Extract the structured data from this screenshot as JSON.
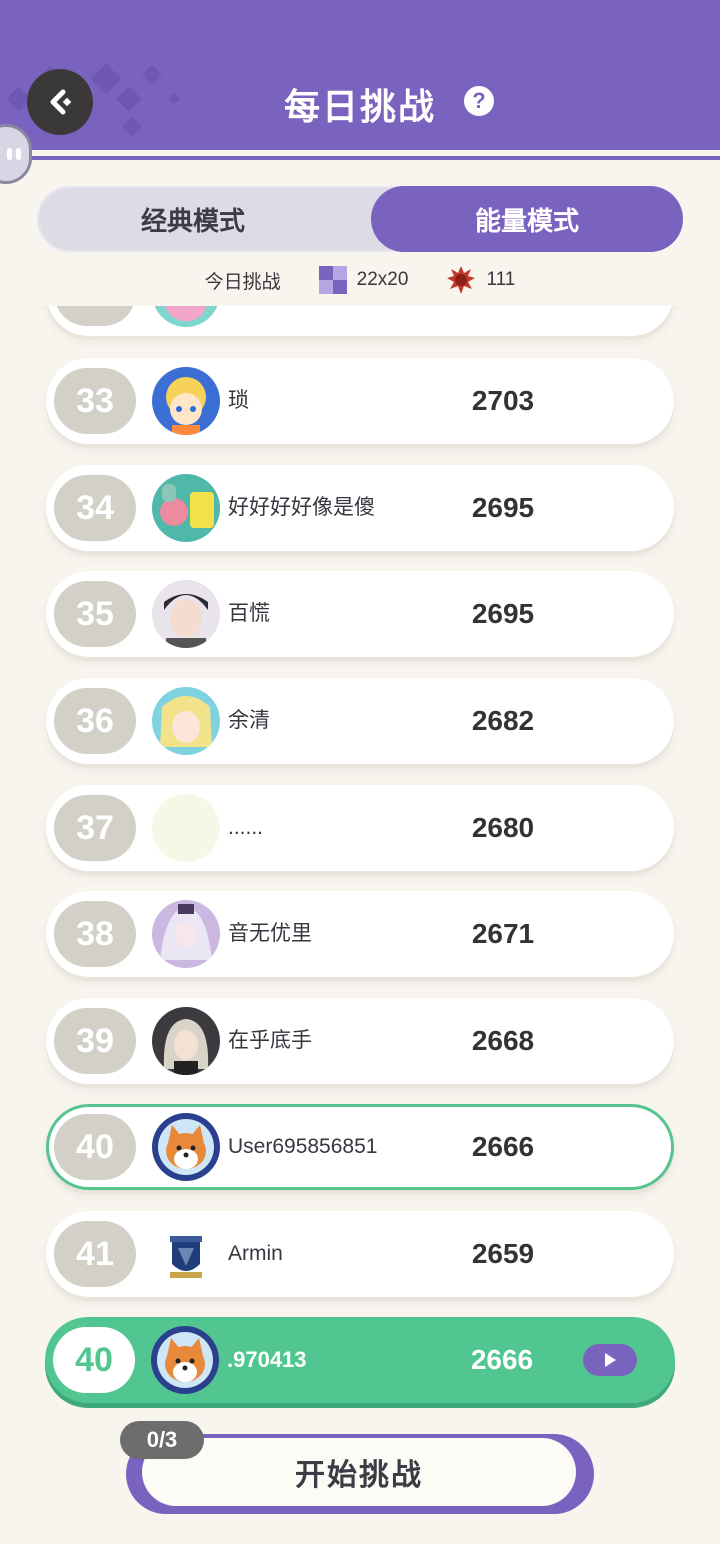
{
  "header": {
    "title": "每日挑战",
    "help_icon": "?"
  },
  "mode_toggle": {
    "classic_label": "经典模式",
    "energy_label": "能量模式",
    "selected": "能量模式"
  },
  "today": {
    "label": "今日挑战",
    "board_size": "22x20",
    "count": "111"
  },
  "leaderboard": [
    {
      "rank": "33",
      "name": "琐",
      "score": "2703",
      "avatar": "anime-girl-blonde"
    },
    {
      "rank": "34",
      "name": "好好好好像是傻",
      "score": "2695",
      "avatar": "cartoon-characters"
    },
    {
      "rank": "35",
      "name": "百慌",
      "score": "2695",
      "avatar": "dark-hair-boy"
    },
    {
      "rank": "36",
      "name": "余清",
      "score": "2682",
      "avatar": "blonde-anime-blue"
    },
    {
      "rank": "37",
      "name": "......",
      "score": "2680",
      "avatar": "blank-pale"
    },
    {
      "rank": "38",
      "name": "音无优里",
      "score": "2671",
      "avatar": "purple-anime-girl"
    },
    {
      "rank": "39",
      "name": "在乎底手",
      "score": "2668",
      "avatar": "silver-hair-girl"
    },
    {
      "rank": "40",
      "name": "User695856851",
      "score": "2666",
      "avatar": "shiba-dog",
      "highlight": true
    },
    {
      "rank": "41",
      "name": "Armin",
      "score": "2659",
      "avatar": "ravenclaw-crest"
    }
  ],
  "my_entry": {
    "rank": "40",
    "name": ".970413",
    "score": "2666",
    "avatar": "shiba-dog"
  },
  "start": {
    "label": "开始挑战",
    "attempts": "0/3"
  },
  "colors": {
    "primary": "#7a63bf",
    "green": "#52c690",
    "background": "#f8f5ef",
    "rank_bg": "#d3d0c8"
  }
}
